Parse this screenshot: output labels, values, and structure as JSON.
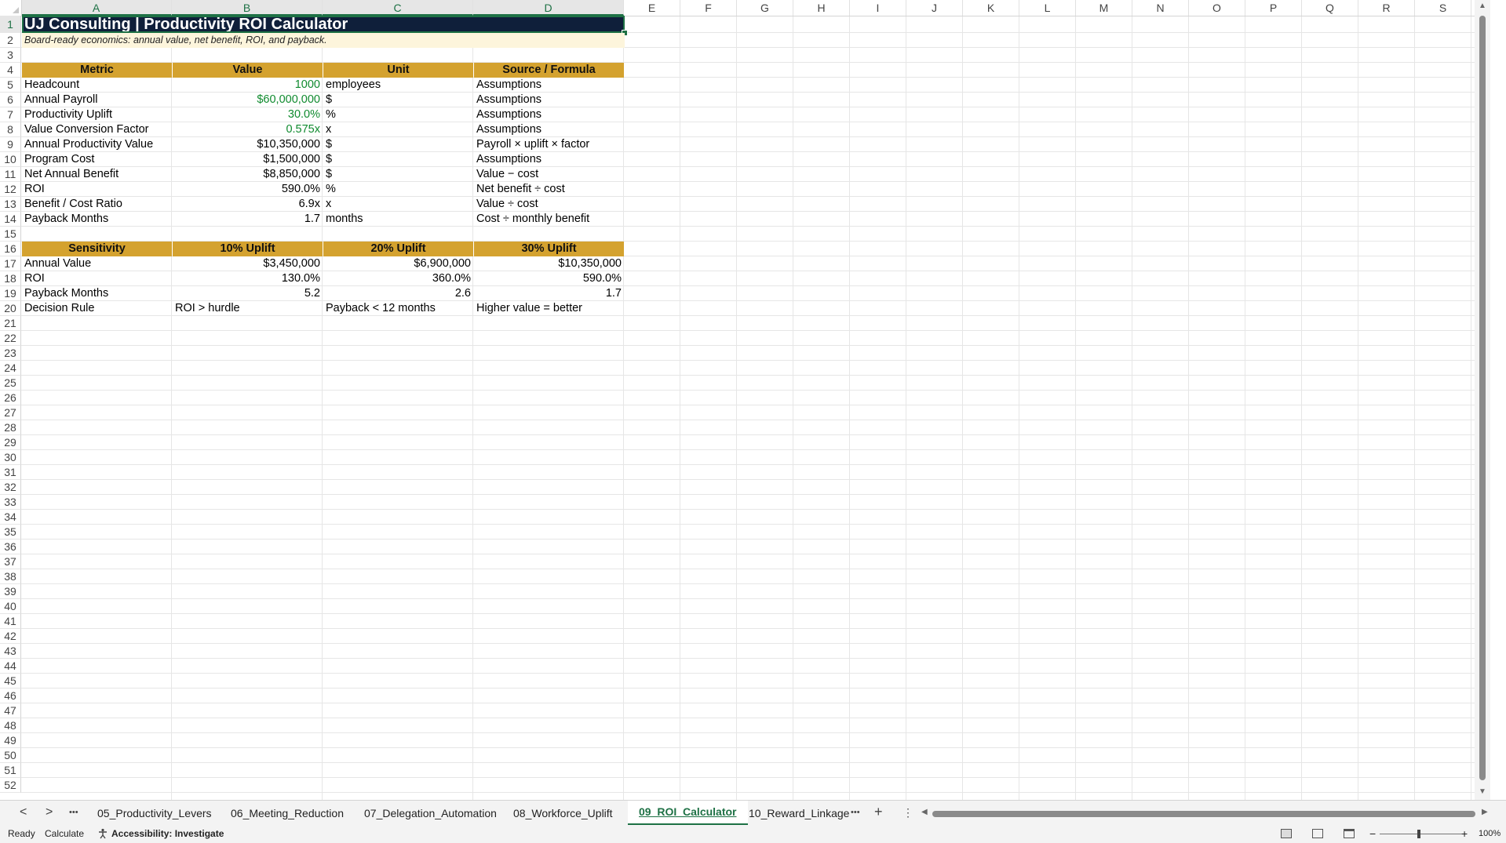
{
  "columns": [
    "A",
    "B",
    "C",
    "D",
    "E",
    "F",
    "G",
    "H",
    "I",
    "J",
    "K",
    "L",
    "M",
    "N",
    "O",
    "P",
    "Q",
    "R",
    "S"
  ],
  "row_numbers": [
    "1",
    "2",
    "3",
    "4",
    "5",
    "6",
    "7",
    "8",
    "9",
    "10",
    "11",
    "12",
    "13",
    "14",
    "15",
    "16",
    "17",
    "18",
    "19",
    "20",
    "21",
    "22",
    "23",
    "24",
    "25",
    "26",
    "27",
    "28",
    "29",
    "30",
    "31",
    "32",
    "33",
    "34",
    "35",
    "36",
    "37",
    "38",
    "39",
    "40",
    "41",
    "42",
    "43",
    "44",
    "45",
    "46",
    "47",
    "48",
    "49",
    "50",
    "51",
    "52"
  ],
  "sheet": {
    "title": "UJ Consulting | Productivity ROI Calculator",
    "subtitle": "Board-ready economics: annual value, net benefit, ROI, and payback.",
    "metrics_header": [
      "Metric",
      "Value",
      "Unit",
      "Source / Formula"
    ],
    "metrics": [
      {
        "metric": "Headcount",
        "value": "1000",
        "unit": "employees",
        "source": "Assumptions",
        "input": true
      },
      {
        "metric": "Annual Payroll",
        "value": "$60,000,000",
        "unit": "$",
        "source": "Assumptions",
        "input": true
      },
      {
        "metric": "Productivity Uplift",
        "value": "30.0%",
        "unit": "%",
        "source": "Assumptions",
        "input": true
      },
      {
        "metric": "Value Conversion Factor",
        "value": "0.575x",
        "unit": "x",
        "source": "Assumptions",
        "input": true
      },
      {
        "metric": "Annual Productivity Value",
        "value": "$10,350,000",
        "unit": "$",
        "source": "Payroll × uplift × factor",
        "input": false
      },
      {
        "metric": "Program Cost",
        "value": "$1,500,000",
        "unit": "$",
        "source": "Assumptions",
        "input": false
      },
      {
        "metric": "Net Annual Benefit",
        "value": "$8,850,000",
        "unit": "$",
        "source": "Value − cost",
        "input": false
      },
      {
        "metric": "ROI",
        "value": "590.0%",
        "unit": "%",
        "source": "Net benefit ÷ cost",
        "input": false
      },
      {
        "metric": "Benefit / Cost Ratio",
        "value": "6.9x",
        "unit": "x",
        "source": "Value ÷ cost",
        "input": false
      },
      {
        "metric": "Payback Months",
        "value": "1.7",
        "unit": "months",
        "source": "Cost ÷ monthly benefit",
        "input": false
      }
    ],
    "sensitivity_header": [
      "Sensitivity",
      "10% Uplift",
      "20% Uplift",
      "30% Uplift"
    ],
    "sensitivity": [
      {
        "label": "Annual Value",
        "v10": "$3,450,000",
        "v20": "$6,900,000",
        "v30": "$10,350,000"
      },
      {
        "label": "ROI",
        "v10": "130.0%",
        "v20": "360.0%",
        "v30": "590.0%"
      },
      {
        "label": "Payback Months",
        "v10": "5.2",
        "v20": "2.6",
        "v30": "1.7"
      }
    ],
    "decision_rule": {
      "label": "Decision Rule",
      "b": "ROI > hurdle",
      "c": "Payback < 12 months",
      "d": "Higher value = better"
    }
  },
  "tabs": [
    "05_Productivity_Levers",
    "06_Meeting_Reduction",
    "07_Delegation_Automation",
    "08_Workforce_Uplift",
    "09_ROI_Calculator",
    "10_Reward_Linkage"
  ],
  "active_tab": "09_ROI_Calculator",
  "tab_controls": {
    "prev": "<",
    "next": ">",
    "more": "•••",
    "add": "+",
    "options": "⋮"
  },
  "status": {
    "ready": "Ready",
    "calculate": "Calculate",
    "accessibility": "Accessibility: Investigate",
    "zoom": "100%",
    "zoom_minus": "−",
    "zoom_plus": "+"
  },
  "colors": {
    "title_bg": "#0f1f3a",
    "header_gold": "#d4a22f",
    "subtitle_bg": "#fdf5dc",
    "input_green": "#0f8a2e",
    "accent": "#1e7145"
  },
  "icons": [
    "accessibility-icon",
    "normal-view-icon",
    "page-layout-view-icon",
    "page-break-view-icon"
  ]
}
